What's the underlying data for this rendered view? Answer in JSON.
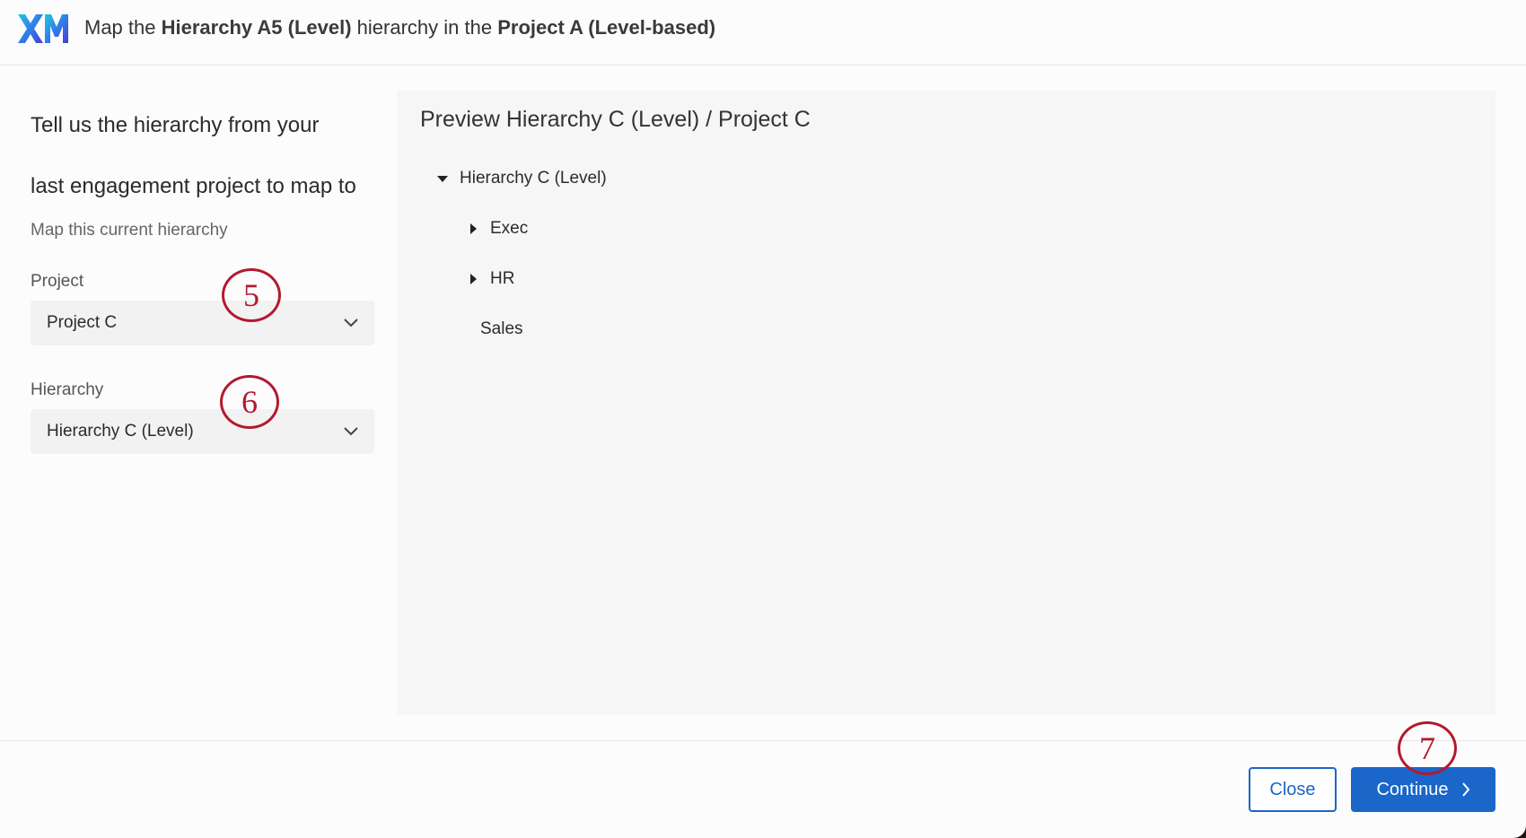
{
  "header": {
    "logo_text": "XM",
    "title_parts": {
      "p1": "Map the ",
      "b1": "Hierarchy A5 (Level)",
      "p2": " hierarchy in the ",
      "b2": "Project A (Level-based)"
    }
  },
  "left_panel": {
    "heading_line1": "Tell us the hierarchy from your",
    "heading_line2": "last engagement project to map to",
    "subtext": "Map this current hierarchy",
    "project_label": "Project",
    "project_value": "Project C",
    "hierarchy_label": "Hierarchy",
    "hierarchy_value": "Hierarchy C (Level)"
  },
  "preview": {
    "title": "Preview Hierarchy C (Level) / Project C",
    "tree": {
      "root": "Hierarchy C (Level)",
      "children": [
        "Exec",
        "HR",
        "Sales"
      ]
    }
  },
  "annotations": [
    "5",
    "6",
    "7"
  ],
  "footer": {
    "close_label": "Close",
    "continue_label": "Continue"
  },
  "colors": {
    "primary": "#1a66c9",
    "annotation": "#b3192f",
    "preview_bg": "#f6f6f6"
  }
}
